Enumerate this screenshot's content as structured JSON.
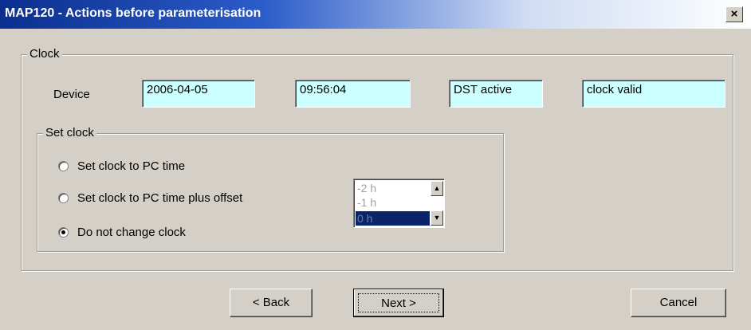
{
  "window": {
    "title": "MAP120 - Actions before parameterisation",
    "close_label": "×"
  },
  "clock": {
    "group_label": "Clock",
    "device_label": "Device",
    "date": "2006-04-05",
    "time": "09:56:04",
    "dst": "DST active",
    "status": "clock valid"
  },
  "set_clock": {
    "group_label": "Set clock",
    "options": [
      {
        "label": "Set clock to PC time",
        "checked": false
      },
      {
        "label": "Set clock to PC time plus offset",
        "checked": false
      },
      {
        "label": "Do not change clock",
        "checked": true
      }
    ],
    "offset_options": [
      "-2 h",
      "-1 h",
      "0 h"
    ],
    "offset_selected": "0 h"
  },
  "buttons": {
    "back": "< Back",
    "next": "Next >",
    "cancel": "Cancel"
  },
  "colors": {
    "field_bg": "#ccffff",
    "dialog_bg": "#d4d0c8",
    "title_start": "#0b2f8f",
    "selection": "#0a246a"
  }
}
